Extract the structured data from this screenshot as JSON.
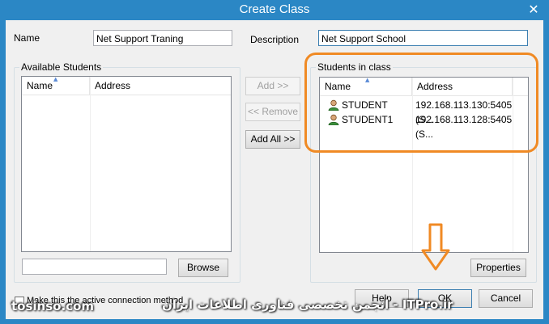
{
  "window": {
    "title": "Create Class",
    "close_glyph": "✕"
  },
  "form": {
    "name_label": "Name",
    "name_value": "Net Support Traning",
    "description_label": "Description",
    "description_value": "Net Support School"
  },
  "available": {
    "title": "Available Students",
    "columns": [
      "Name",
      "Address"
    ],
    "filter_value": "",
    "browse_label": "Browse"
  },
  "middle_buttons": {
    "add": "Add >>",
    "remove": "<< Remove",
    "add_all": "Add All >>"
  },
  "in_class": {
    "title": "Students in class",
    "columns": [
      "Name",
      "Address"
    ],
    "rows": [
      {
        "name": "STUDENT",
        "address": "192.168.113.130:5405 (S...",
        "icon": "user-icon"
      },
      {
        "name": "STUDENT1",
        "address": "192.168.113.128:5405 (S...",
        "icon": "user-icon"
      }
    ],
    "properties_label": "Properties"
  },
  "footer": {
    "active_connection_label": "Make this the active connection method",
    "help": "Help",
    "ok": "OK",
    "cancel": "Cancel"
  },
  "watermark": {
    "left": "tosinso.com",
    "right": "ITPro.ir - انجمن تخصصی فناوری اطلاعات ایران"
  },
  "colors": {
    "highlight": "#f08a24",
    "titlebar": "#2b87c5"
  }
}
